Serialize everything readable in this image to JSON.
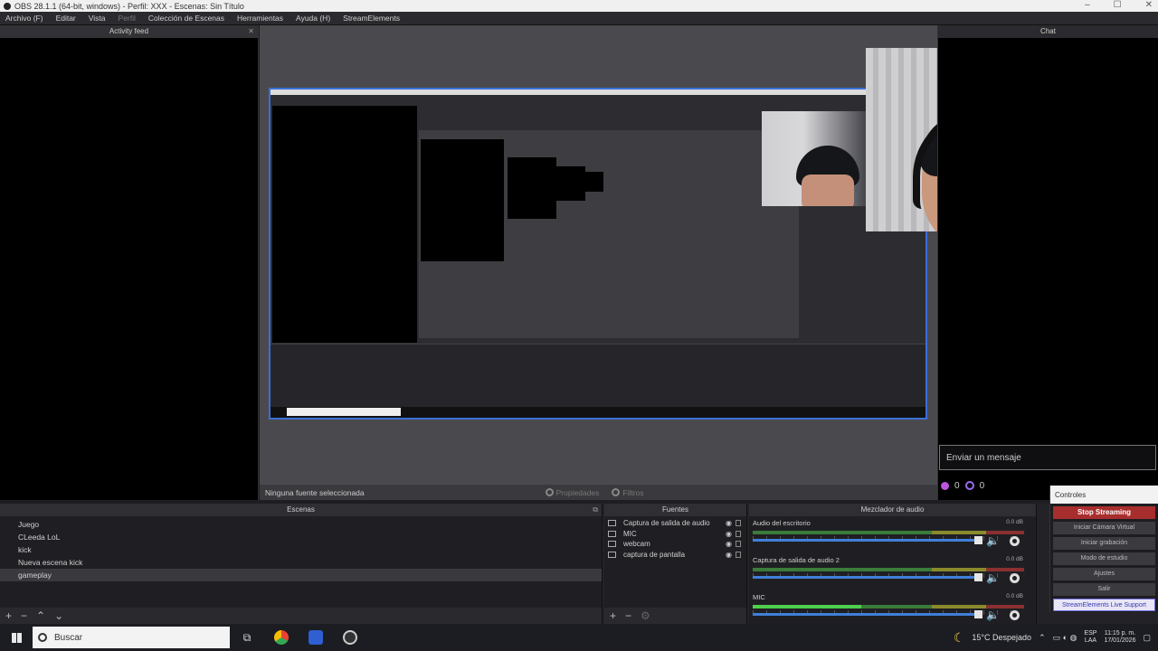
{
  "window": {
    "title": "OBS 28.1.1 (64-bit, windows) - Perfil: XXX - Escenas: Sin Título"
  },
  "menu": [
    "Archivo (F)",
    "Editar",
    "Vista",
    "Perfil",
    "Colección de Escenas",
    "Herramientas",
    "Ayuda (H)",
    "StreamElements"
  ],
  "activity_feed": {
    "title": "Activity feed"
  },
  "chat": {
    "title": "Chat",
    "input_placeholder": "Enviar un mensaje",
    "points": "0",
    "viewers": "0"
  },
  "preview_bar": {
    "status": "Ninguna fuente seleccionada",
    "properties": "Propiedades",
    "filters": "Filtros"
  },
  "scenes": {
    "title": "Escenas",
    "items": [
      "Juego",
      "CLeeda LoL",
      "kick",
      "Nueva escena kick",
      "gameplay"
    ],
    "selected_index": 4
  },
  "sources": {
    "title": "Fuentes",
    "items": [
      "Captura de salida de audio",
      "MIC",
      "webcam",
      "captura de pantalla"
    ]
  },
  "mixer": {
    "title": "Mezclador de audio",
    "channels": [
      {
        "name": "Audio del escritorio",
        "db": "0.0 dB"
      },
      {
        "name": "Captura de salida de audio 2",
        "db": "0.0 dB"
      },
      {
        "name": "MIC",
        "db": "0.0 dB"
      }
    ]
  },
  "controls": {
    "title": "Controles",
    "stop_streaming": "Stop Streaming",
    "virtual_cam": "Iniciar Cámara Virtual",
    "start_recording": "Iniciar grabación",
    "studio_mode": "Modo de estudio",
    "settings": "Ajustes",
    "exit": "Salir",
    "support": "StreamElements Live Support"
  },
  "taskbar": {
    "search": "Buscar",
    "weather": "15°C Despejado",
    "lang": "ESP",
    "lang_sub": "LAA",
    "time": "11:15 p. m.",
    "date": "17/01/2026"
  }
}
